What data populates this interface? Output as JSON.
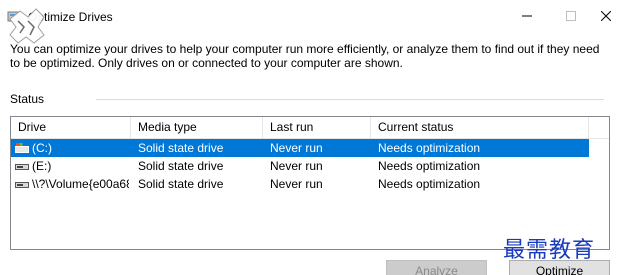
{
  "window": {
    "title": "Optimize Drives"
  },
  "description": "You can optimize your drives to help your computer run more efficiently, or analyze them to find out if they need to be optimized. Only drives on or connected to your computer are shown.",
  "status": {
    "label": "Status"
  },
  "drives_table": {
    "columns": [
      "Drive",
      "Media type",
      "Last run",
      "Current status"
    ],
    "rows": [
      {
        "drive": "(C:)",
        "media_type": "Solid state drive",
        "last_run": "Never run",
        "current_status": "Needs optimization",
        "selected": true,
        "icon": "system-drive-icon"
      },
      {
        "drive": "(E:)",
        "media_type": "Solid state drive",
        "last_run": "Never run",
        "current_status": "Needs optimization",
        "selected": false,
        "icon": "drive-icon"
      },
      {
        "drive": "\\\\?\\Volume{e00a68...",
        "media_type": "Solid state drive",
        "last_run": "Never run",
        "current_status": "Needs optimization",
        "selected": false,
        "icon": "drive-icon"
      }
    ]
  },
  "buttons": {
    "analyze": "Analyze",
    "optimize": "Optimize"
  },
  "watermark": "最需教育",
  "colors": {
    "selection": "#0078d7",
    "watermark": "#1a3bbd"
  }
}
